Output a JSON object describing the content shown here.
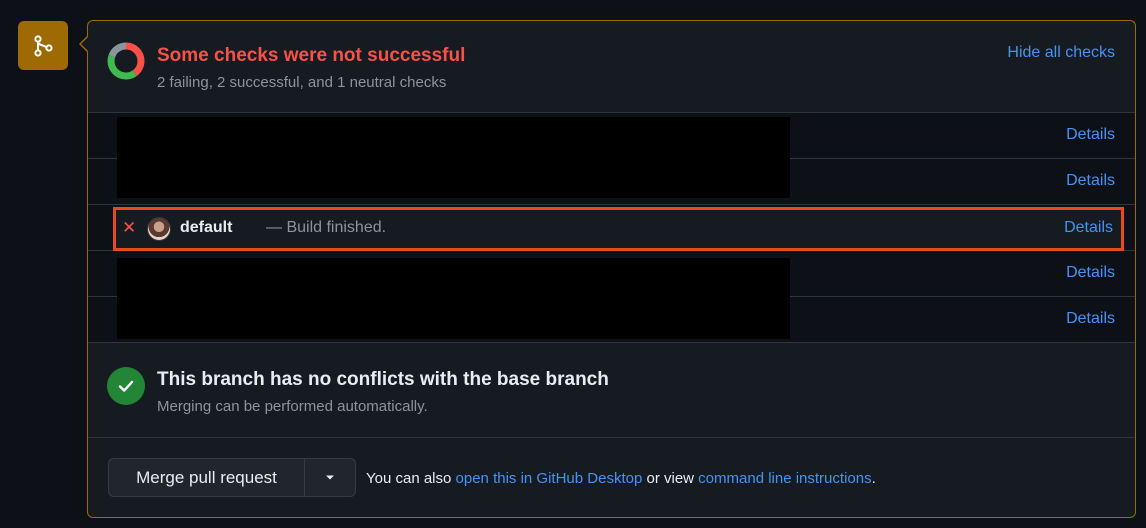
{
  "checks": {
    "title": "Some checks were not successful",
    "subtitle": "2 failing, 2 successful, and 1 neutral checks",
    "hide_label": "Hide all checks",
    "summary_colors": {
      "failing": "#f85149",
      "successful": "#3fb950",
      "neutral": "#8b949e"
    },
    "rows": [
      {
        "details_label": "Details",
        "redacted": true
      },
      {
        "details_label": "Details",
        "redacted": true
      },
      {
        "status": "failing",
        "name": "default",
        "description": "— Build finished.",
        "details_label": "Details",
        "highlighted": true
      },
      {
        "details_label": "Details",
        "redacted": true
      },
      {
        "details_label": "Details",
        "redacted": true
      }
    ]
  },
  "conflicts": {
    "title": "This branch has no conflicts with the base branch",
    "subtitle": "Merging can be performed automatically."
  },
  "merge": {
    "button_label": "Merge pull request",
    "note_prefix": "You can also",
    "desktop_link": "open this in GitHub Desktop",
    "note_middle": "or view",
    "cli_link": "command line instructions",
    "note_suffix": "."
  },
  "colors": {
    "accent": "#4493f8",
    "danger": "#f85149",
    "success": "#238636",
    "merge_icon_bg": "#9e6a03",
    "highlight_border": "#e8491d"
  }
}
